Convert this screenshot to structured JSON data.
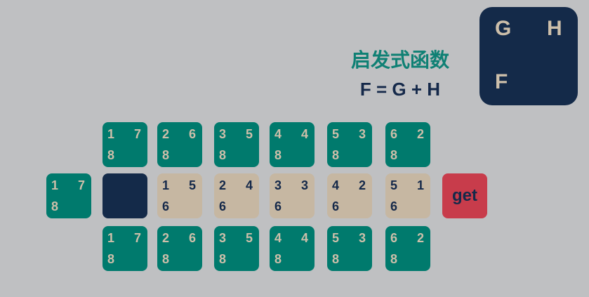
{
  "legend": {
    "g": "G",
    "h": "H",
    "f": "F"
  },
  "title": "启发式函数",
  "formula": "F = G + H",
  "button_label": "get",
  "colors": {
    "background": "#bfc0c2",
    "teal": "#007a6d",
    "tan": "#c6b7a2",
    "navy": "#142a49",
    "red": "#c83c4b"
  },
  "top_row": [
    {
      "g": "1",
      "h": "7",
      "f": "8"
    },
    {
      "g": "2",
      "h": "6",
      "f": "8"
    },
    {
      "g": "3",
      "h": "5",
      "f": "8"
    },
    {
      "g": "4",
      "h": "4",
      "f": "8"
    },
    {
      "g": "5",
      "h": "3",
      "f": "8"
    },
    {
      "g": "6",
      "h": "2",
      "f": "8"
    }
  ],
  "middle_left": {
    "g": "1",
    "h": "7",
    "f": "8"
  },
  "middle_row": [
    {
      "g": "1",
      "h": "5",
      "f": "6"
    },
    {
      "g": "2",
      "h": "4",
      "f": "6"
    },
    {
      "g": "3",
      "h": "3",
      "f": "6"
    },
    {
      "g": "4",
      "h": "2",
      "f": "6"
    },
    {
      "g": "5",
      "h": "1",
      "f": "6"
    }
  ],
  "bottom_row": [
    {
      "g": "1",
      "h": "7",
      "f": "8"
    },
    {
      "g": "2",
      "h": "6",
      "f": "8"
    },
    {
      "g": "3",
      "h": "5",
      "f": "8"
    },
    {
      "g": "4",
      "h": "4",
      "f": "8"
    },
    {
      "g": "5",
      "h": "3",
      "f": "8"
    },
    {
      "g": "6",
      "h": "2",
      "f": "8"
    }
  ]
}
